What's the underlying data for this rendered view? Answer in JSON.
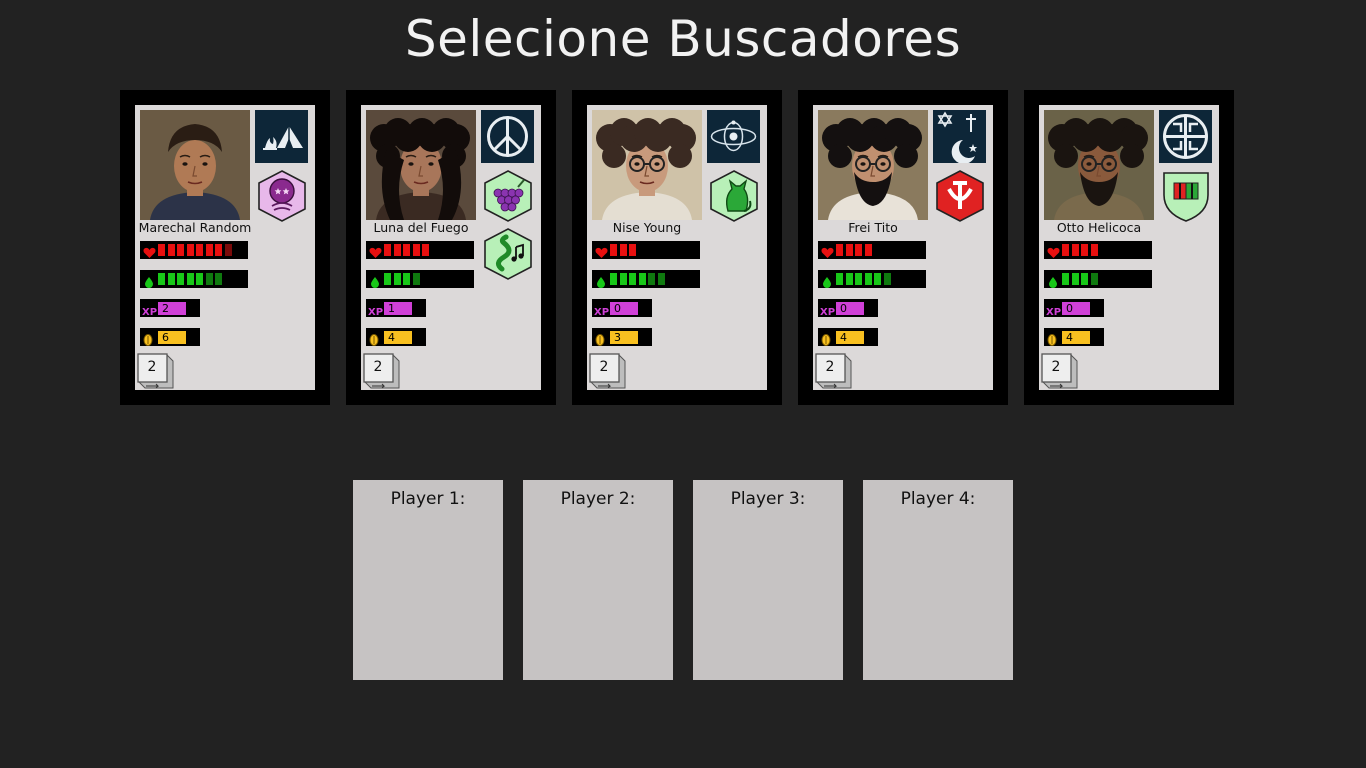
{
  "title": "Selecione Buscadores",
  "colors": {
    "background": "#222222",
    "card_frame": "#000000",
    "card_face": "#dcd9d9",
    "health": "#e81010",
    "sanity": "#18c818",
    "sanity_dim": "#0f7a0f",
    "xp": "#d040d8",
    "coin": "#f8c020",
    "slot": "#c6c3c3"
  },
  "characters": [
    {
      "name": "Marechal Random",
      "role_icon": "tent-campfire-icon",
      "traits": [
        "stars-badge-icon"
      ],
      "health": 7,
      "health_dim": 1,
      "sanity": 5,
      "sanity_dim": 2,
      "xp": "2",
      "coins": "6",
      "dice": "2"
    },
    {
      "name": "Luna del Fuego",
      "role_icon": "peace-sign-icon",
      "traits": [
        "grapes-icon",
        "snake-music-icon"
      ],
      "health": 5,
      "health_dim": 0,
      "sanity": 3,
      "sanity_dim": 1,
      "xp": "1",
      "coins": "4",
      "dice": "2"
    },
    {
      "name": "Nise Young",
      "role_icon": "atom-orbit-icon",
      "traits": [
        "cat-icon"
      ],
      "health": 3,
      "health_dim": 0,
      "sanity": 4,
      "sanity_dim": 2,
      "xp": "0",
      "coins": "3",
      "dice": "2"
    },
    {
      "name": "Frei Tito",
      "role_icon": "religions-icon",
      "traits": [
        "hammer-sickle-icon"
      ],
      "health": 4,
      "health_dim": 0,
      "sanity": 5,
      "sanity_dim": 1,
      "xp": "0",
      "coins": "4",
      "dice": "2"
    },
    {
      "name": "Otto Helicoca",
      "role_icon": "knot-emblem-icon",
      "traits": [
        "shield-bars-icon"
      ],
      "health": 4,
      "health_dim": 0,
      "sanity": 3,
      "sanity_dim": 1,
      "xp": "0",
      "coins": "4",
      "dice": "2"
    }
  ],
  "players": [
    {
      "label": "Player 1:"
    },
    {
      "label": "Player 2:"
    },
    {
      "label": "Player 3:"
    },
    {
      "label": "Player 4:"
    }
  ],
  "stat_icons": {
    "health": "heart-icon",
    "sanity": "drop-icon",
    "xp_text": "XP",
    "coins": "coin-icon"
  }
}
